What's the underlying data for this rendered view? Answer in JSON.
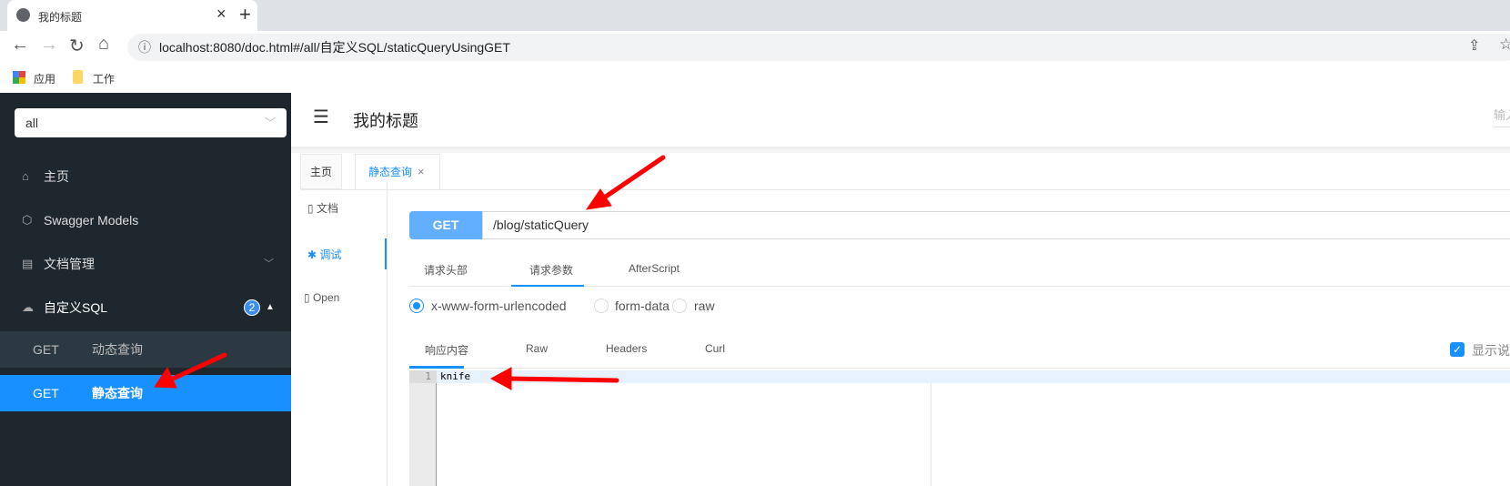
{
  "browser": {
    "tab_title": "我的标题",
    "tab_close": "×",
    "new_tab": "+",
    "url": "localhost:8080/doc.html#/all/自定义SQL/staticQueryUsingGET",
    "bookmarks": [
      {
        "label": "应用",
        "icon": "apps-grid-icon"
      },
      {
        "label": "工作",
        "icon": "folder-icon"
      }
    ]
  },
  "sidebar": {
    "group_select": "all",
    "items": [
      {
        "label": "主页",
        "icon": "home-icon"
      },
      {
        "label": "Swagger Models",
        "icon": "cube-icon"
      },
      {
        "label": "文档管理",
        "icon": "doc-settings-icon"
      },
      {
        "label": "自定义SQL",
        "icon": "cloud-icon",
        "badge": "2"
      }
    ],
    "endpoints": [
      {
        "method": "GET",
        "name": "动态查询"
      },
      {
        "method": "GET",
        "name": "静态查询",
        "selected": true
      }
    ]
  },
  "header": {
    "title": "我的标题",
    "search_placeholder": "输入"
  },
  "page_tabs": [
    {
      "label": "主页"
    },
    {
      "label": "静态查询",
      "close": "×",
      "active": true
    }
  ],
  "side_nav": [
    {
      "label": "文档"
    },
    {
      "label": "调试",
      "active": true
    },
    {
      "label": "Open"
    }
  ],
  "request": {
    "method": "GET",
    "path": "/blog/staticQuery",
    "tabs": [
      "请求头部",
      "请求参数",
      "AfterScript"
    ],
    "active_tab": "请求参数",
    "body_types": [
      "x-www-form-urlencoded",
      "form-data",
      "raw"
    ],
    "selected_body_type": "x-www-form-urlencoded"
  },
  "response": {
    "tabs": [
      "响应内容",
      "Raw",
      "Headers",
      "Curl"
    ],
    "active_tab": "响应内容",
    "show_desc_label": "显示说",
    "show_desc_checked": true,
    "lines": [
      {
        "no": "1",
        "text": "knife"
      }
    ]
  },
  "colors": {
    "accent": "#1890ff",
    "sidebar_bg": "#1f272e",
    "get_method": "#61affe",
    "annotation_arrow": "#ff0000"
  }
}
